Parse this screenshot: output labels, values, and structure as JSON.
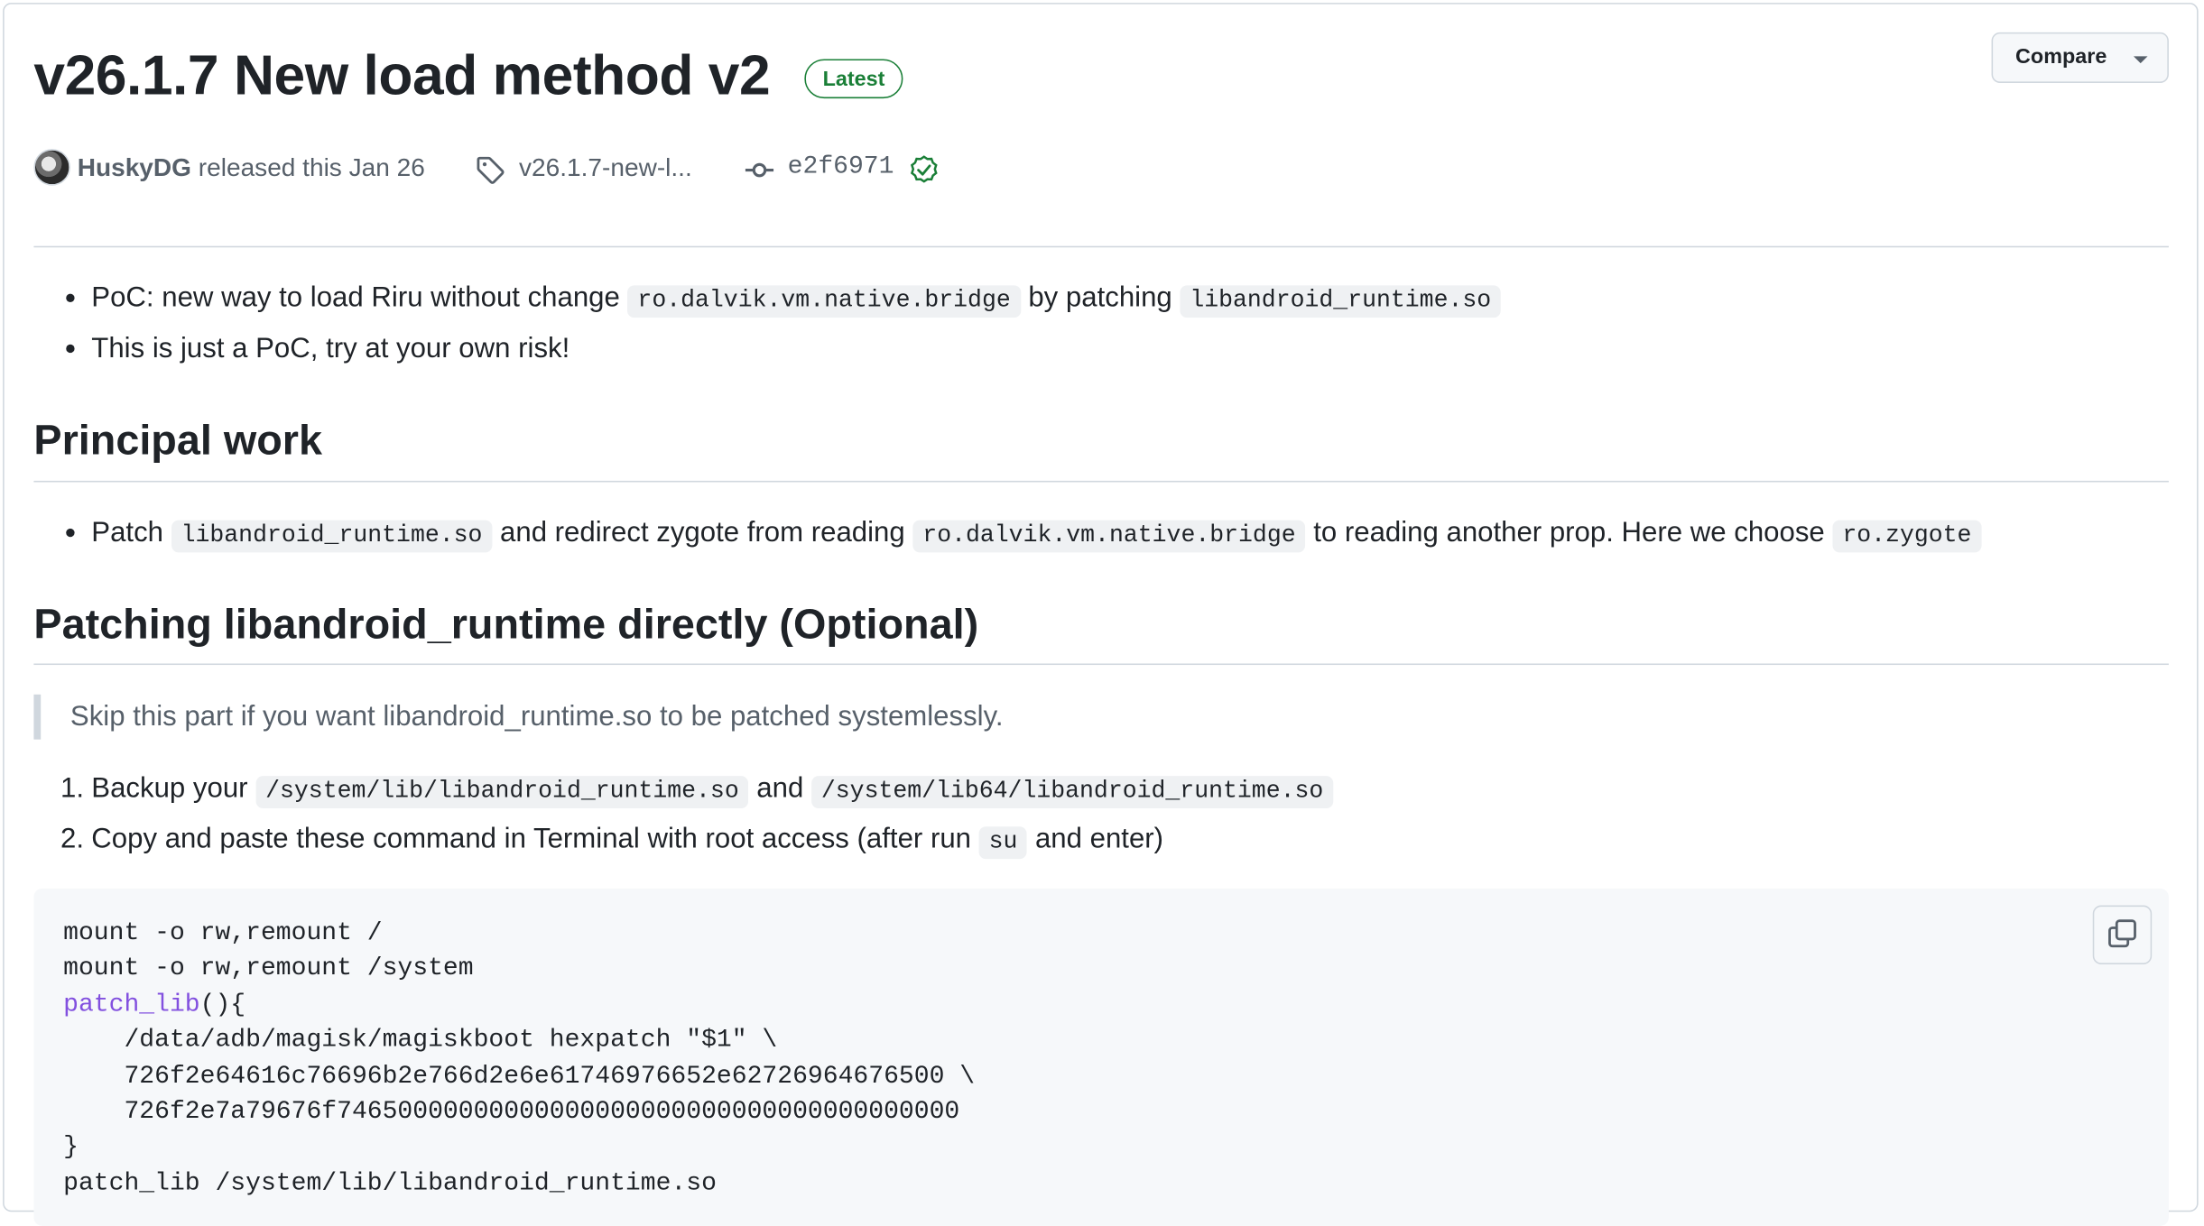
{
  "release": {
    "title": "v26.1.7 New load method v2",
    "badge": "Latest",
    "compare_label": "Compare",
    "author": "HuskyDG",
    "released_text": "released this Jan 26",
    "tag": "v26.1.7-new-l...",
    "commit": "e2f6971"
  },
  "intro": {
    "item1": {
      "t1": "PoC: new way to load Riru without change",
      "c1": "ro.dalvik.vm.native.bridge",
      "t2": "by patching",
      "c2": "libandroid_runtime.so"
    },
    "item2": "This is just a PoC, try at your own risk!"
  },
  "principal": {
    "heading": "Principal work",
    "item": {
      "t1": "Patch",
      "c1": "libandroid_runtime.so",
      "t2": "and redirect zygote from reading",
      "c2": "ro.dalvik.vm.native.bridge",
      "t3": "to reading another prop. Here we choose",
      "c3": "ro.zygote"
    }
  },
  "patching": {
    "heading": "Patching libandroid_runtime directly (Optional)",
    "quote": "Skip this part if you want libandroid_runtime.so to be patched systemlessly.",
    "step1": {
      "num": "1.",
      "t1": "Backup your",
      "c1": "/system/lib/libandroid_runtime.so",
      "t2": "and",
      "c2": "/system/lib64/libandroid_runtime.so"
    },
    "step2": {
      "num": "2.",
      "t1": "Copy and paste these command in Terminal with root access (after run",
      "c1": "su",
      "t2": "and enter)"
    }
  },
  "code": {
    "l1": "mount -o rw,remount /",
    "l2": "mount -o rw,remount /system",
    "l3_fn": "patch_lib",
    "l3_rest": "(){",
    "l4": "    /data/adb/magisk/magiskboot hexpatch \"$1\" \\",
    "l5": "    726f2e64616c76696b2e766d2e6e61746976652e62726964676500 \\",
    "l6": "    726f2e7a79676f74650000000000000000000000000000000000000",
    "l7": "}",
    "l8": "patch_lib /system/lib/libandroid_runtime.so"
  }
}
